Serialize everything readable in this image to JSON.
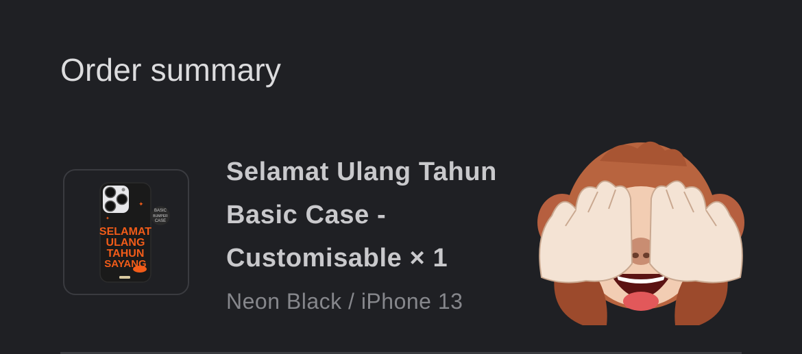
{
  "order_summary": {
    "title": "Order summary",
    "item": {
      "name": "Selamat Ulang Tahun Basic Case - Customisable × 1",
      "variant": "Neon Black / iPhone 13",
      "thumbnail": {
        "case_art_lines": [
          "SELAMAT",
          "ULANG",
          "TAHUN",
          "SAYANG"
        ],
        "badge_lines": [
          "BASIC",
          "BUMPER",
          "CASE"
        ],
        "case_color": "#1a1a1a",
        "text_color": "#f25c19"
      }
    },
    "emoji": "see-no-evil-monkey-icon"
  },
  "colors": {
    "background": "#1f2024",
    "title_text": "#dcdcde",
    "item_text": "#c9c9cc",
    "muted_text": "#86878c",
    "border": "#3a3b40"
  }
}
